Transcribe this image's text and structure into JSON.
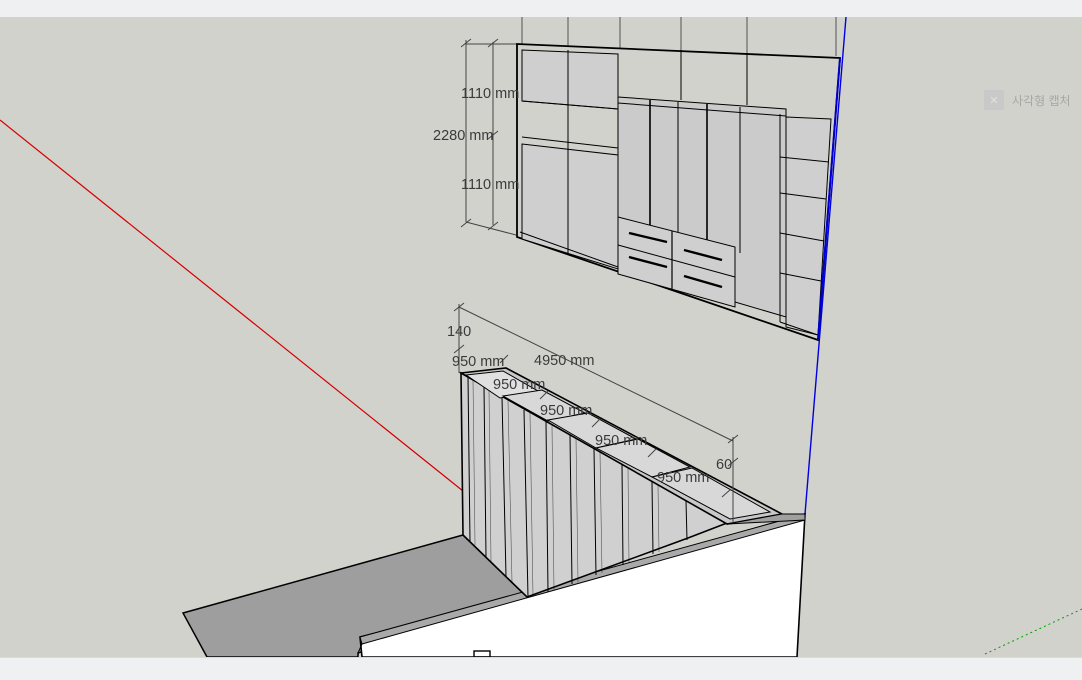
{
  "viewport": {
    "dimensions": {
      "wardrobe_upper_height": "1110 mm",
      "wardrobe_total_height": "2280 mm",
      "wardrobe_lower_height": "1110 mm",
      "base_depth": "140",
      "top_total_width": "4950 mm",
      "module_1_width": "950 mm",
      "module_2_width": "950 mm",
      "module_3_width": "950 mm",
      "module_4_width": "950 mm",
      "module_5_width": "950 mm",
      "side_offset": "60"
    },
    "capture_hint": {
      "label": "사각형 캡처",
      "icon": "close-icon"
    }
  },
  "colors": {
    "background": "#d2d2cd",
    "x_axis": "#d40000",
    "z_axis": "#0000e0",
    "y_axis": "#00a000",
    "face_light": "#d4d4d4",
    "face_mid": "#b0b0b0",
    "face_dark": "#9e9e9e",
    "face_white": "#ffffff"
  }
}
